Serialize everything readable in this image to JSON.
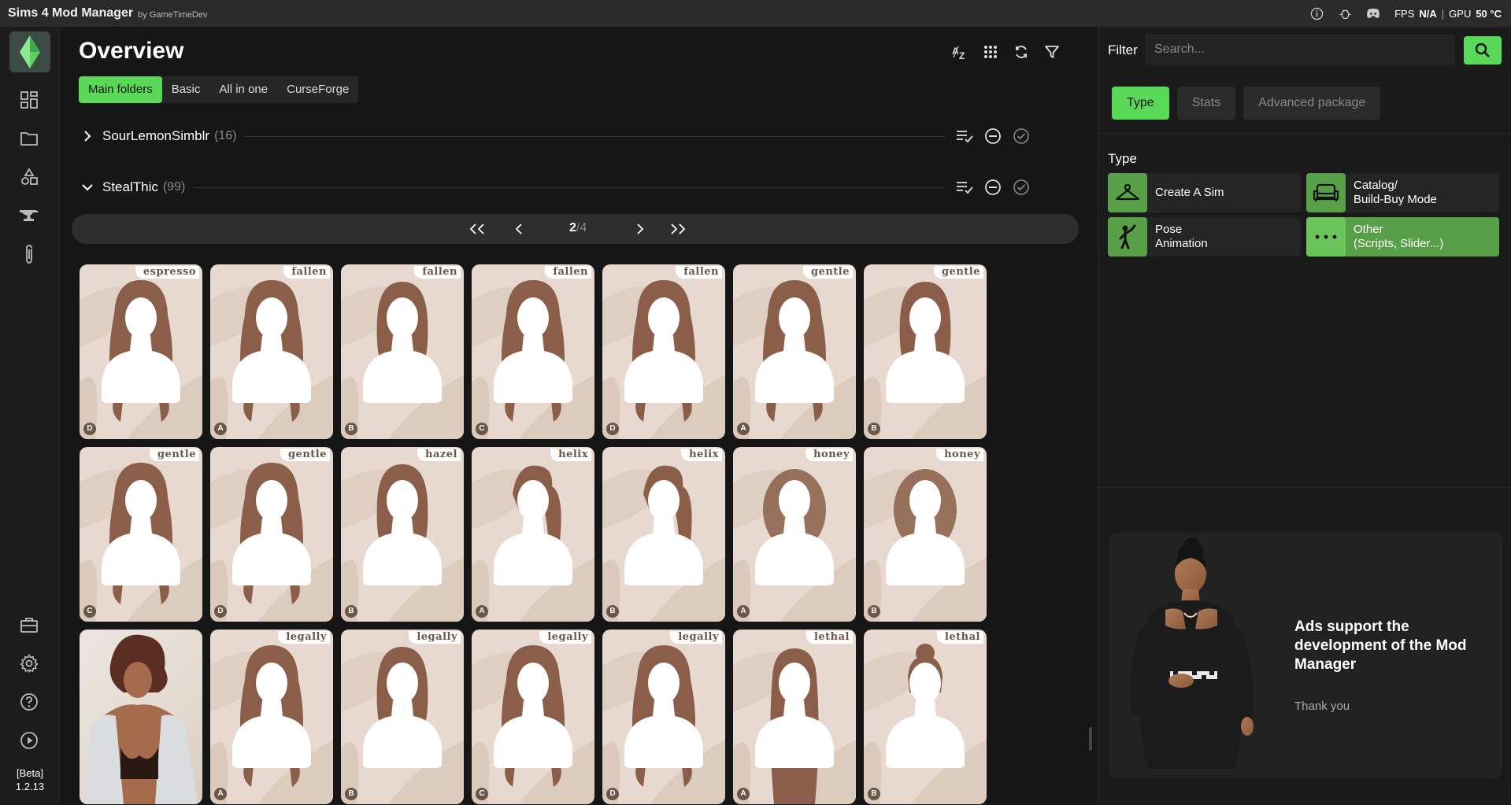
{
  "titlebar": {
    "app_title": "Sims 4 Mod Manager",
    "app_by": "by GameTimeDev",
    "icons": [
      "info-icon",
      "bug-icon",
      "discord-icon",
      "maximize-icon",
      "close-icon"
    ],
    "fps_label": "FPS",
    "fps_value": "N/A",
    "gpu_label": "GPU",
    "gpu_value": "50 °C"
  },
  "sidebar": {
    "icons": [
      "dashboard-icon",
      "folder-icon",
      "shapes-icon",
      "anvil-icon",
      "paperclip-icon",
      "toolbox-icon",
      "gear-icon",
      "help-icon",
      "play-icon"
    ],
    "version_tag": "[Beta]",
    "version": "1.2.13"
  },
  "main": {
    "title": "Overview",
    "toolbar_icons": [
      "sort-az-icon",
      "grid-icon",
      "refresh-icon",
      "filter-icon"
    ],
    "tabs": [
      {
        "label": "Main folders",
        "active": true
      },
      {
        "label": "Basic",
        "active": false
      },
      {
        "label": "All in one",
        "active": false
      },
      {
        "label": "CurseForge",
        "active": false
      }
    ],
    "folders": [
      {
        "name": "SourLemonSimblr",
        "count": "(16)",
        "expanded": false
      },
      {
        "name": "StealThic",
        "count": "(99)",
        "expanded": true
      }
    ],
    "pager": {
      "current": "2",
      "total": "/4"
    },
    "cards": [
      {
        "label": "espresso",
        "badge": "D"
      },
      {
        "label": "fallen",
        "badge": "A"
      },
      {
        "label": "fallen",
        "badge": "B"
      },
      {
        "label": "fallen",
        "badge": "C"
      },
      {
        "label": "fallen",
        "badge": "D"
      },
      {
        "label": "gentle",
        "badge": "A"
      },
      {
        "label": "gentle",
        "badge": "B"
      },
      {
        "label": "gentle",
        "badge": "C"
      },
      {
        "label": "gentle",
        "badge": "D"
      },
      {
        "label": "hazel",
        "badge": "B"
      },
      {
        "label": "helix",
        "badge": "A"
      },
      {
        "label": "helix",
        "badge": "B"
      },
      {
        "label": "honey",
        "badge": "A"
      },
      {
        "label": "honey",
        "badge": "B"
      },
      {
        "label": "",
        "badge": ""
      },
      {
        "label": "legally",
        "badge": "A"
      },
      {
        "label": "legally",
        "badge": "B"
      },
      {
        "label": "legally",
        "badge": "C"
      },
      {
        "label": "legally",
        "badge": "D"
      },
      {
        "label": "lethal",
        "badge": "A"
      },
      {
        "label": "lethal",
        "badge": "B"
      }
    ]
  },
  "filter_panel": {
    "filter_label": "Filter",
    "search_placeholder": "Search...",
    "tabs": [
      {
        "label": "Type",
        "active": true
      },
      {
        "label": "Stats",
        "active": false
      },
      {
        "label": "Advanced package",
        "active": false
      }
    ],
    "type_heading": "Type",
    "types": [
      {
        "label": "Create A Sim",
        "icon": "hanger-icon",
        "active": false
      },
      {
        "label": "Catalog/\nBuild-Buy Mode",
        "icon": "sofa-icon",
        "active": false
      },
      {
        "label": "Pose\nAnimation",
        "icon": "pose-icon",
        "active": false
      },
      {
        "label": "Other\n(Scripts, Slider...)",
        "icon": "dots-icon",
        "active": true
      }
    ],
    "ad": {
      "title": "Ads support the development of the Mod Manager",
      "thanks": "Thank you"
    }
  },
  "colors": {
    "accent": "#59d957",
    "type_green": "#58a048",
    "card_bg": "#e7d9cf",
    "hair": "#8a5e48"
  }
}
